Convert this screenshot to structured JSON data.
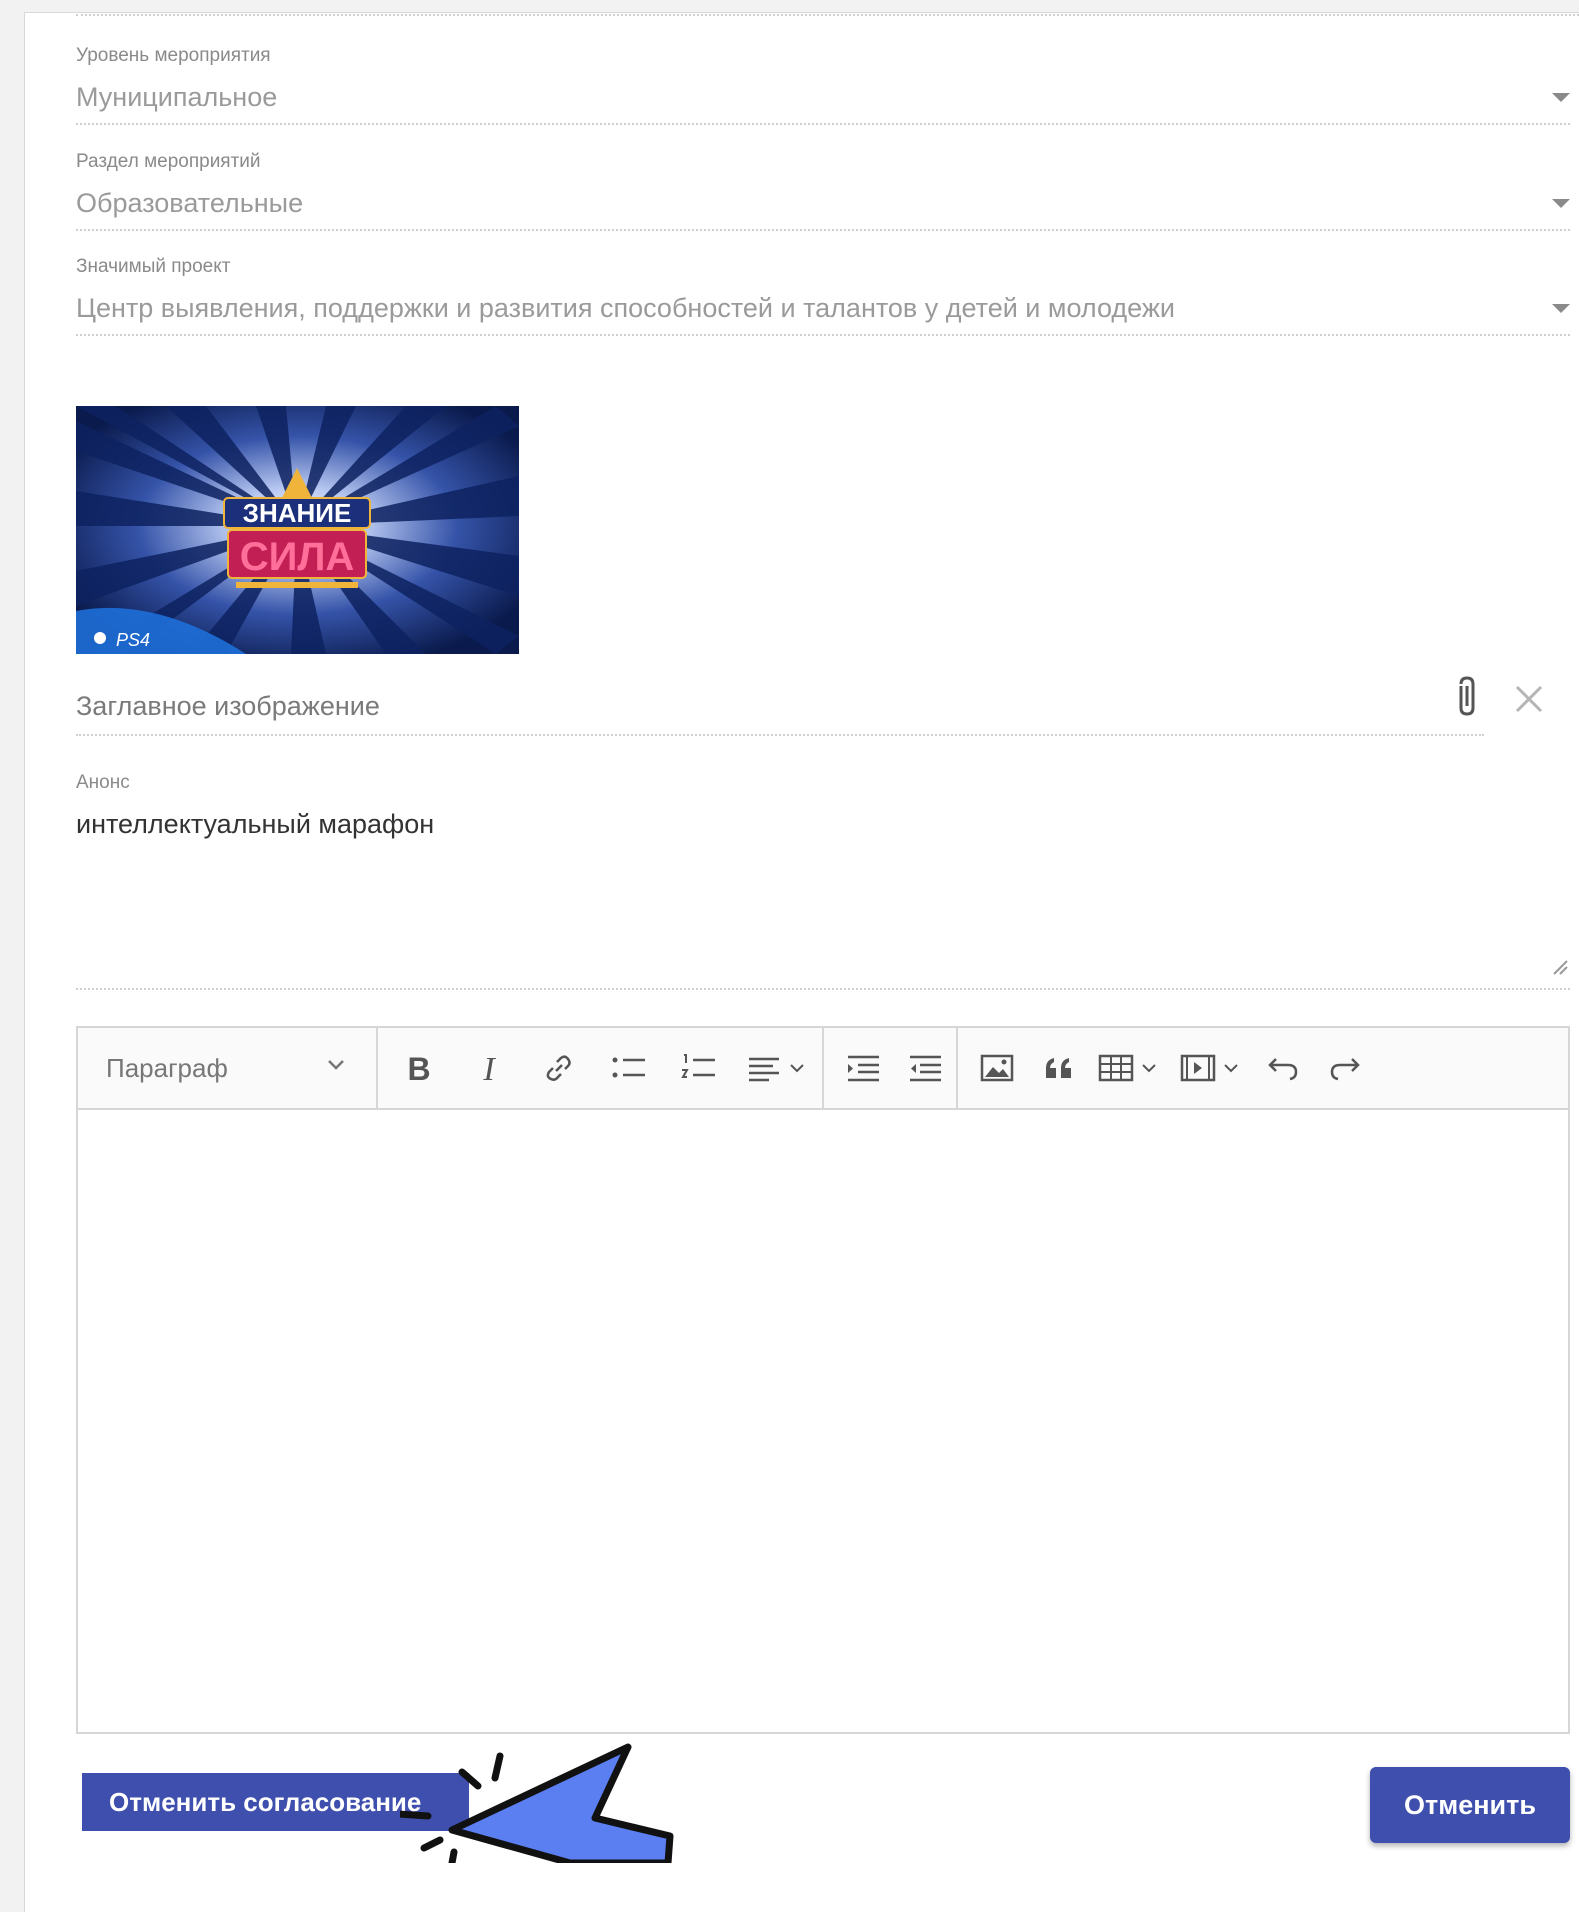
{
  "fields": {
    "level": {
      "label": "Уровень мероприятия",
      "value": "Муниципальное"
    },
    "section": {
      "label": "Раздел мероприятий",
      "value": "Образовательные"
    },
    "project": {
      "label": "Значимый проект",
      "value": "Центр выявления, поддержки и развития способностей и талантов у детей и молодежи"
    }
  },
  "cover": {
    "thumbnail": {
      "title_line1": "ЗНАНИЕ",
      "title_line2": "СИЛА",
      "platform_badge": "PS4"
    },
    "label": "Заглавное изображение",
    "attach_icon": "paperclip-icon",
    "clear_icon": "close-icon"
  },
  "anons": {
    "label": "Анонс",
    "value": "интеллектуальный марафон"
  },
  "editor": {
    "paragraph_select": "Параграф",
    "toolbar": [
      "bold-icon",
      "italic-icon",
      "link-icon",
      "bulleted-list-icon",
      "numbered-list-icon",
      "align-icon",
      "indent-icon",
      "outdent-icon",
      "image-icon",
      "quote-icon",
      "table-icon",
      "media-icon",
      "undo-icon",
      "redo-icon"
    ]
  },
  "actions": {
    "cancel_approval": "Отменить согласование",
    "cancel": "Отменить"
  },
  "colors": {
    "primary": "#3f4fae",
    "cursor": "#5b7ff0"
  }
}
